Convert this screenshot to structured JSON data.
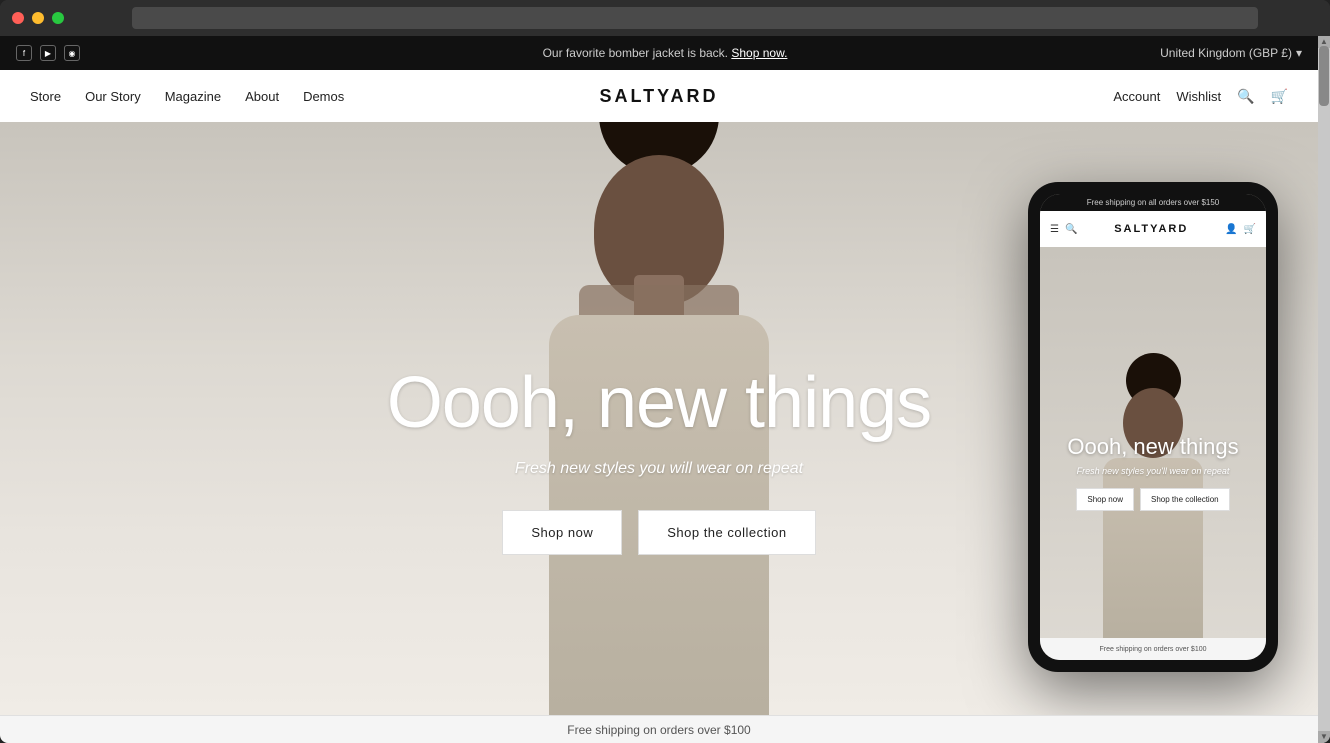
{
  "browser": {
    "dots": [
      "red",
      "yellow",
      "green"
    ]
  },
  "announcement": {
    "social_icons": [
      "f",
      "▶",
      "◉"
    ],
    "message": "Our favorite bomber jacket is back.",
    "shop_now": "Shop now.",
    "region": "United Kingdom (GBP £)",
    "chevron": "▾"
  },
  "nav": {
    "logo": "SALTYARD",
    "links": [
      "Store",
      "Our Story",
      "Magazine",
      "About",
      "Demos"
    ],
    "right_links": [
      "Account",
      "Wishlist"
    ],
    "search_icon": "🔍",
    "cart_icon": "🛒"
  },
  "hero": {
    "title": "Oooh, new things",
    "subtitle": "Fresh new styles you will wear on repeat",
    "btn_shop_now": "Shop now",
    "btn_shop_collection": "Shop the collection"
  },
  "bottom_bar": {
    "text": "Free shipping on orders over $100"
  },
  "phone": {
    "top_bar": "Free shipping on all orders over $150",
    "logo": "SALTYARD",
    "title": "Oooh, new things",
    "subtitle": "Fresh new styles you'll wear on repeat",
    "btn_shop_now": "Shop now",
    "btn_shop_collection": "Shop the collection",
    "bottom_bar": "Free shipping on orders over $100"
  }
}
